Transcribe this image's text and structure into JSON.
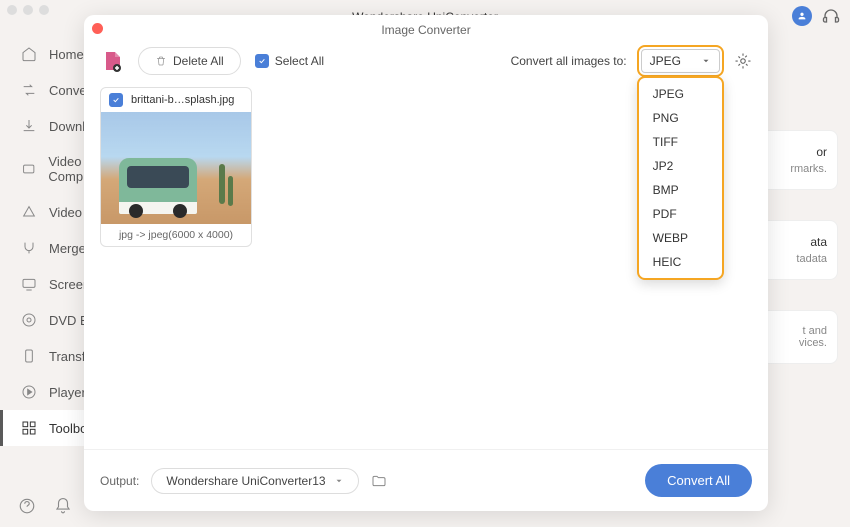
{
  "app_title": "Wondershare UniConverter",
  "modal": {
    "title": "Image Converter",
    "delete_all": "Delete All",
    "select_all": "Select All",
    "convert_to_label": "Convert all images to:",
    "selected_format": "JPEG",
    "format_options": [
      "JPEG",
      "PNG",
      "TIFF",
      "JP2",
      "BMP",
      "PDF",
      "WEBP",
      "HEIC"
    ]
  },
  "sidebar": {
    "items": [
      {
        "label": "Home"
      },
      {
        "label": "Converter"
      },
      {
        "label": "Downloader"
      },
      {
        "label": "Video Compressor"
      },
      {
        "label": "Video Editor"
      },
      {
        "label": "Merger"
      },
      {
        "label": "Screen Recorder"
      },
      {
        "label": "DVD Burner"
      },
      {
        "label": "Transfer"
      },
      {
        "label": "Player"
      },
      {
        "label": "Toolbox"
      }
    ]
  },
  "image_card": {
    "filename": "brittani-b…splash.jpg",
    "conversion_info": "jpg -> jpeg(6000 x 4000)"
  },
  "output": {
    "label": "Output:",
    "path": "Wondershare UniConverter13"
  },
  "convert_all": "Convert All",
  "fragments": {
    "card1_title": "or",
    "card1_sub": "rmarks.",
    "card2_title": "ata",
    "card2_sub": "tadata",
    "card3_line1": "t and",
    "card3_line2": "vices."
  }
}
